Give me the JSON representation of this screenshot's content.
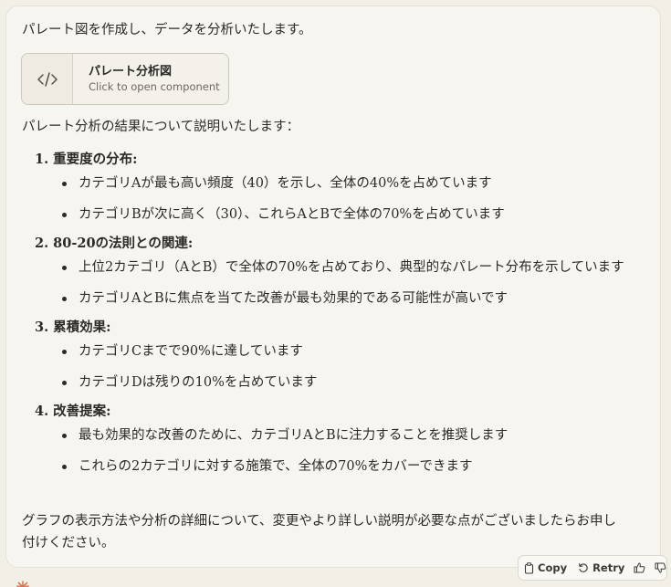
{
  "intro": "パレート図を作成し、データを分析いたします。",
  "artifact": {
    "title": "パレート分析図",
    "subtitle": "Click to open component",
    "icon": "code-icon"
  },
  "summary": "パレート分析の結果について説明いたします：",
  "sections": [
    {
      "heading": "1. 重要度の分布:",
      "bullets": [
        "カテゴリAが最も高い頻度（40）を示し、全体の40%を占めています",
        "カテゴリBが次に高く（30）、これらAとBで全体の70%を占めています"
      ]
    },
    {
      "heading": "2. 80-20の法則との関連:",
      "bullets": [
        "上位2カテゴリ（AとB）で全体の70%を占めており、典型的なパレート分布を示しています",
        "カテゴリAとBに焦点を当てた改善が最も効果的である可能性が高いです"
      ]
    },
    {
      "heading": "3. 累積効果:",
      "bullets": [
        "カテゴリCまでで90%に達しています",
        "カテゴリDは残りの10%を占めています"
      ]
    },
    {
      "heading": "4. 改善提案:",
      "bullets": [
        "最も効果的な改善のために、カテゴリAとBに注力することを推奨します",
        "これらの2カテゴリに対する施策で、全体の70%をカバーできます"
      ]
    }
  ],
  "closing": "グラフの表示方法や分析の詳細について、変更やより詳しい説明が必要な点がございましたらお申し付けください。",
  "actions": {
    "copy_label": "Copy",
    "retry_label": "Retry",
    "icons": [
      "copy-icon",
      "retry-icon",
      "thumbs-up-icon",
      "thumbs-down-icon"
    ]
  },
  "colors": {
    "page_bg": "#f2efe7",
    "card_bg": "#f7f5f0",
    "text": "#2b2a27",
    "logo": "#d97757"
  }
}
